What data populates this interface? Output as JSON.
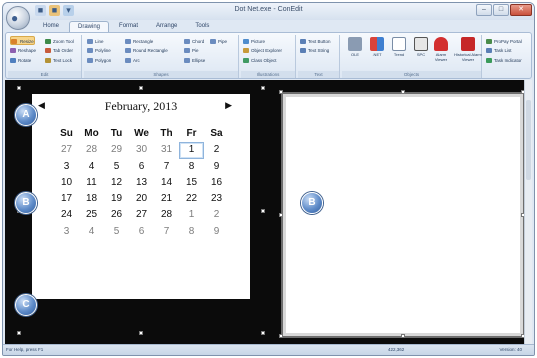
{
  "window": {
    "title": "Dot Net.exe - ConEdit",
    "qat": [
      "■",
      "■",
      "▾"
    ],
    "controls": [
      "–",
      "□",
      "✕"
    ]
  },
  "tabs": [
    "Home",
    "Drawing",
    "Format",
    "Arrange",
    "Tools"
  ],
  "ribbon": {
    "edit": {
      "title": "Edit",
      "items": [
        "Resize",
        "Reshape",
        "Rotate",
        "Zoom Tool",
        "Tab Order",
        "Text Lock"
      ]
    },
    "shapes": {
      "title": "Shapes",
      "items": [
        "Line",
        "Polyline",
        "Polygon",
        "Rectangle",
        "Round Rectangle",
        "Arc",
        "Chord",
        "Pipe",
        "Pie",
        "Ellipse"
      ]
    },
    "illustrations": {
      "title": "Illustrations",
      "items": [
        "Picture",
        "Object Explorer",
        "Class Object"
      ]
    },
    "text": {
      "title": "Text",
      "items": [
        "Text Button",
        "Text String"
      ]
    },
    "objects": {
      "title": "Objects",
      "items": [
        "OLE",
        ".NET",
        "Trend",
        "SPC",
        "Alarm Viewer",
        "Historical Alarm Viewer"
      ]
    },
    "misc": {
      "items": [
        "ProPay Portal",
        "Task List",
        "Task Indicator"
      ]
    }
  },
  "calendar": {
    "month_title": "February, 2013",
    "prev": "◀",
    "next": "▶",
    "weekdays": [
      "Su",
      "Mo",
      "Tu",
      "We",
      "Th",
      "Fr",
      "Sa"
    ],
    "weeks": [
      [
        "27",
        "28",
        "29",
        "30",
        "31",
        "1",
        "2"
      ],
      [
        "3",
        "4",
        "5",
        "6",
        "7",
        "8",
        "9"
      ],
      [
        "10",
        "11",
        "12",
        "13",
        "14",
        "15",
        "16"
      ],
      [
        "17",
        "18",
        "19",
        "20",
        "21",
        "22",
        "23"
      ],
      [
        "24",
        "25",
        "26",
        "27",
        "28",
        "1",
        "2"
      ],
      [
        "3",
        "4",
        "5",
        "6",
        "7",
        "8",
        "9"
      ]
    ]
  },
  "callouts": {
    "a": "A",
    "b1": "B",
    "b2": "B",
    "c": "C"
  },
  "status": {
    "left": "For Help, press F1",
    "middle": "422,362",
    "right": "Version: 40"
  },
  "colors": {
    "ribbon_highlight": "#f7d58a",
    "canvas": "#0b0b0b",
    "callout": "#5f8cc9"
  }
}
